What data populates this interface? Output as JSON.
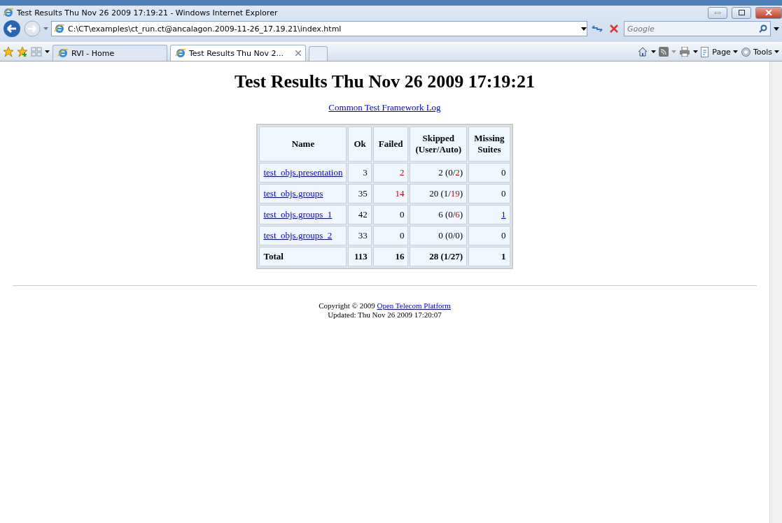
{
  "window": {
    "title": "Test Results Thu Nov 26 2009 17:19:21 - Windows Internet Explorer"
  },
  "address": "C:\\CT\\examples\\ct_run.ct@ancalagon.2009-11-26_17.19.21\\index.html",
  "search": {
    "placeholder": "Google"
  },
  "tabs": [
    {
      "label": "RVI - Home",
      "selected": false
    },
    {
      "label": "Test Results Thu Nov 2...",
      "selected": true
    }
  ],
  "command_bar": [
    "Page",
    "Tools"
  ],
  "page": {
    "heading": "Test Results Thu Nov 26 2009 17:19:21",
    "log_link": "Common Test Framework Log",
    "table": {
      "columns": [
        "Name",
        "Ok",
        "Failed",
        "Skipped (User/Auto)",
        "Missing Suites"
      ],
      "rows": [
        {
          "name": "test_objs.presentation",
          "ok": "3",
          "failed": "2",
          "failed_red": true,
          "skipped": [
            {
              "text": "2 (0/",
              "red": false
            },
            {
              "text": "2",
              "red": true
            },
            {
              "text": ")",
              "red": false
            }
          ],
          "missing": "0",
          "missing_link": false
        },
        {
          "name": "test_objs.groups",
          "ok": "35",
          "failed": "14",
          "failed_red": true,
          "skipped": [
            {
              "text": "20 (1/",
              "red": false
            },
            {
              "text": "19",
              "red": true
            },
            {
              "text": ")",
              "red": false
            }
          ],
          "missing": "0",
          "missing_link": false
        },
        {
          "name": "test_objs.groups_1",
          "ok": "42",
          "failed": "0",
          "failed_red": false,
          "skipped": [
            {
              "text": "6 (0/",
              "red": false
            },
            {
              "text": "6",
              "red": true
            },
            {
              "text": ")",
              "red": false
            }
          ],
          "missing": "1",
          "missing_link": true
        },
        {
          "name": "test_objs.groups_2",
          "ok": "33",
          "failed": "0",
          "failed_red": false,
          "skipped": [
            {
              "text": "0 (0/0)",
              "red": false
            }
          ],
          "missing": "0",
          "missing_link": false
        }
      ],
      "total": {
        "label": "Total",
        "ok": "113",
        "failed": "16",
        "skipped": "28 (1/27)",
        "missing": "1"
      }
    },
    "footer": {
      "copyright": "Copyright © 2009",
      "link": "Open Telecom Platform",
      "updated": "Updated: Thu Nov 26 2009 17:20:07"
    }
  }
}
